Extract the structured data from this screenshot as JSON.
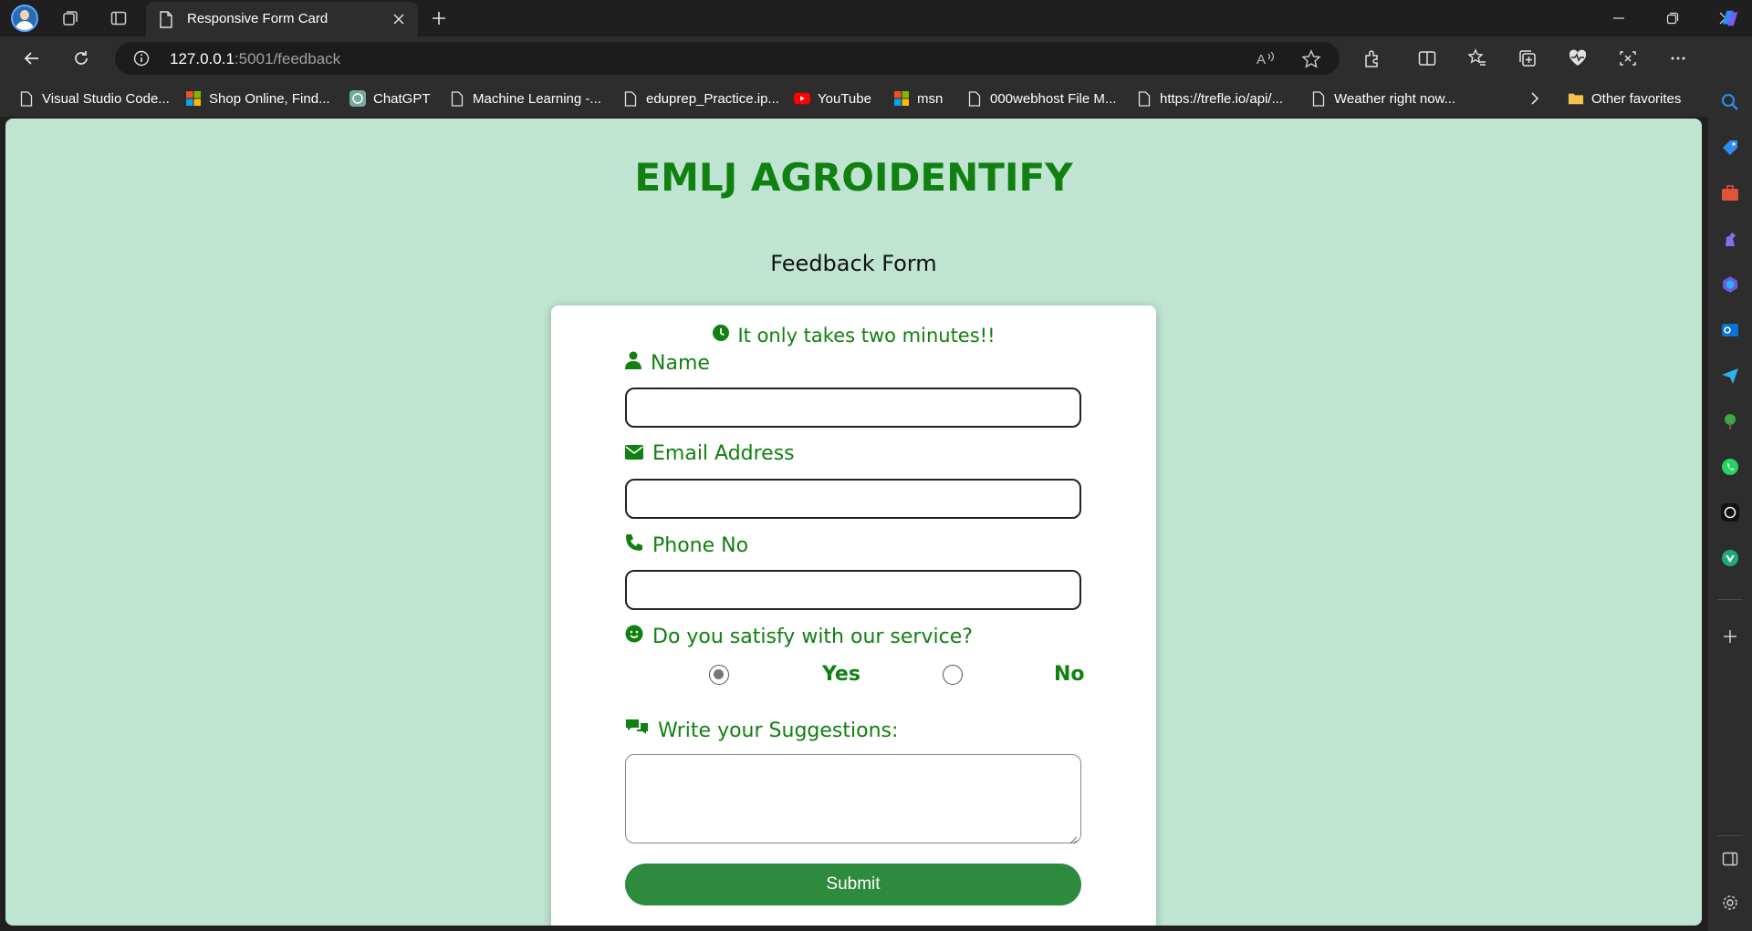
{
  "browser": {
    "tab_title": "Responsive Form Card",
    "url_host": "127.0.0.1",
    "url_path": ":5001/feedback",
    "favorites": [
      {
        "label": "Visual Studio Code...",
        "icon": "page-icon"
      },
      {
        "label": "Shop Online, Find...",
        "icon": "microsoft-logo-icon"
      },
      {
        "label": "ChatGPT",
        "icon": "chatgpt-icon"
      },
      {
        "label": "Machine Learning -...",
        "icon": "page-icon"
      },
      {
        "label": "eduprep_Practice.ip...",
        "icon": "page-icon"
      },
      {
        "label": "YouTube",
        "icon": "youtube-icon"
      },
      {
        "label": "msn",
        "icon": "microsoft-logo-icon"
      },
      {
        "label": "000webhost File M...",
        "icon": "page-icon"
      },
      {
        "label": "https://trefle.io/api/...",
        "icon": "page-icon"
      },
      {
        "label": "Weather right now...",
        "icon": "page-icon"
      }
    ],
    "other_favorites": "Other favorites"
  },
  "page": {
    "brand": "EMLJ AGROIDENTIFY",
    "form_heading": "Feedback Form",
    "tagline": "It only takes two minutes!!",
    "fields": {
      "name_label": "Name",
      "email_label": "Email Address",
      "phone_label": "Phone No",
      "satisfy_label": "Do you satisfy with our service?",
      "yes_label": "Yes",
      "no_label": "No",
      "suggestions_label": "Write your Suggestions:"
    },
    "satisfaction_selected": "Yes",
    "submit_label": "Submit"
  },
  "colors": {
    "page_bg": "#bfe4d2",
    "brand_green": "#108010",
    "submit_green": "#2e8b3e"
  }
}
